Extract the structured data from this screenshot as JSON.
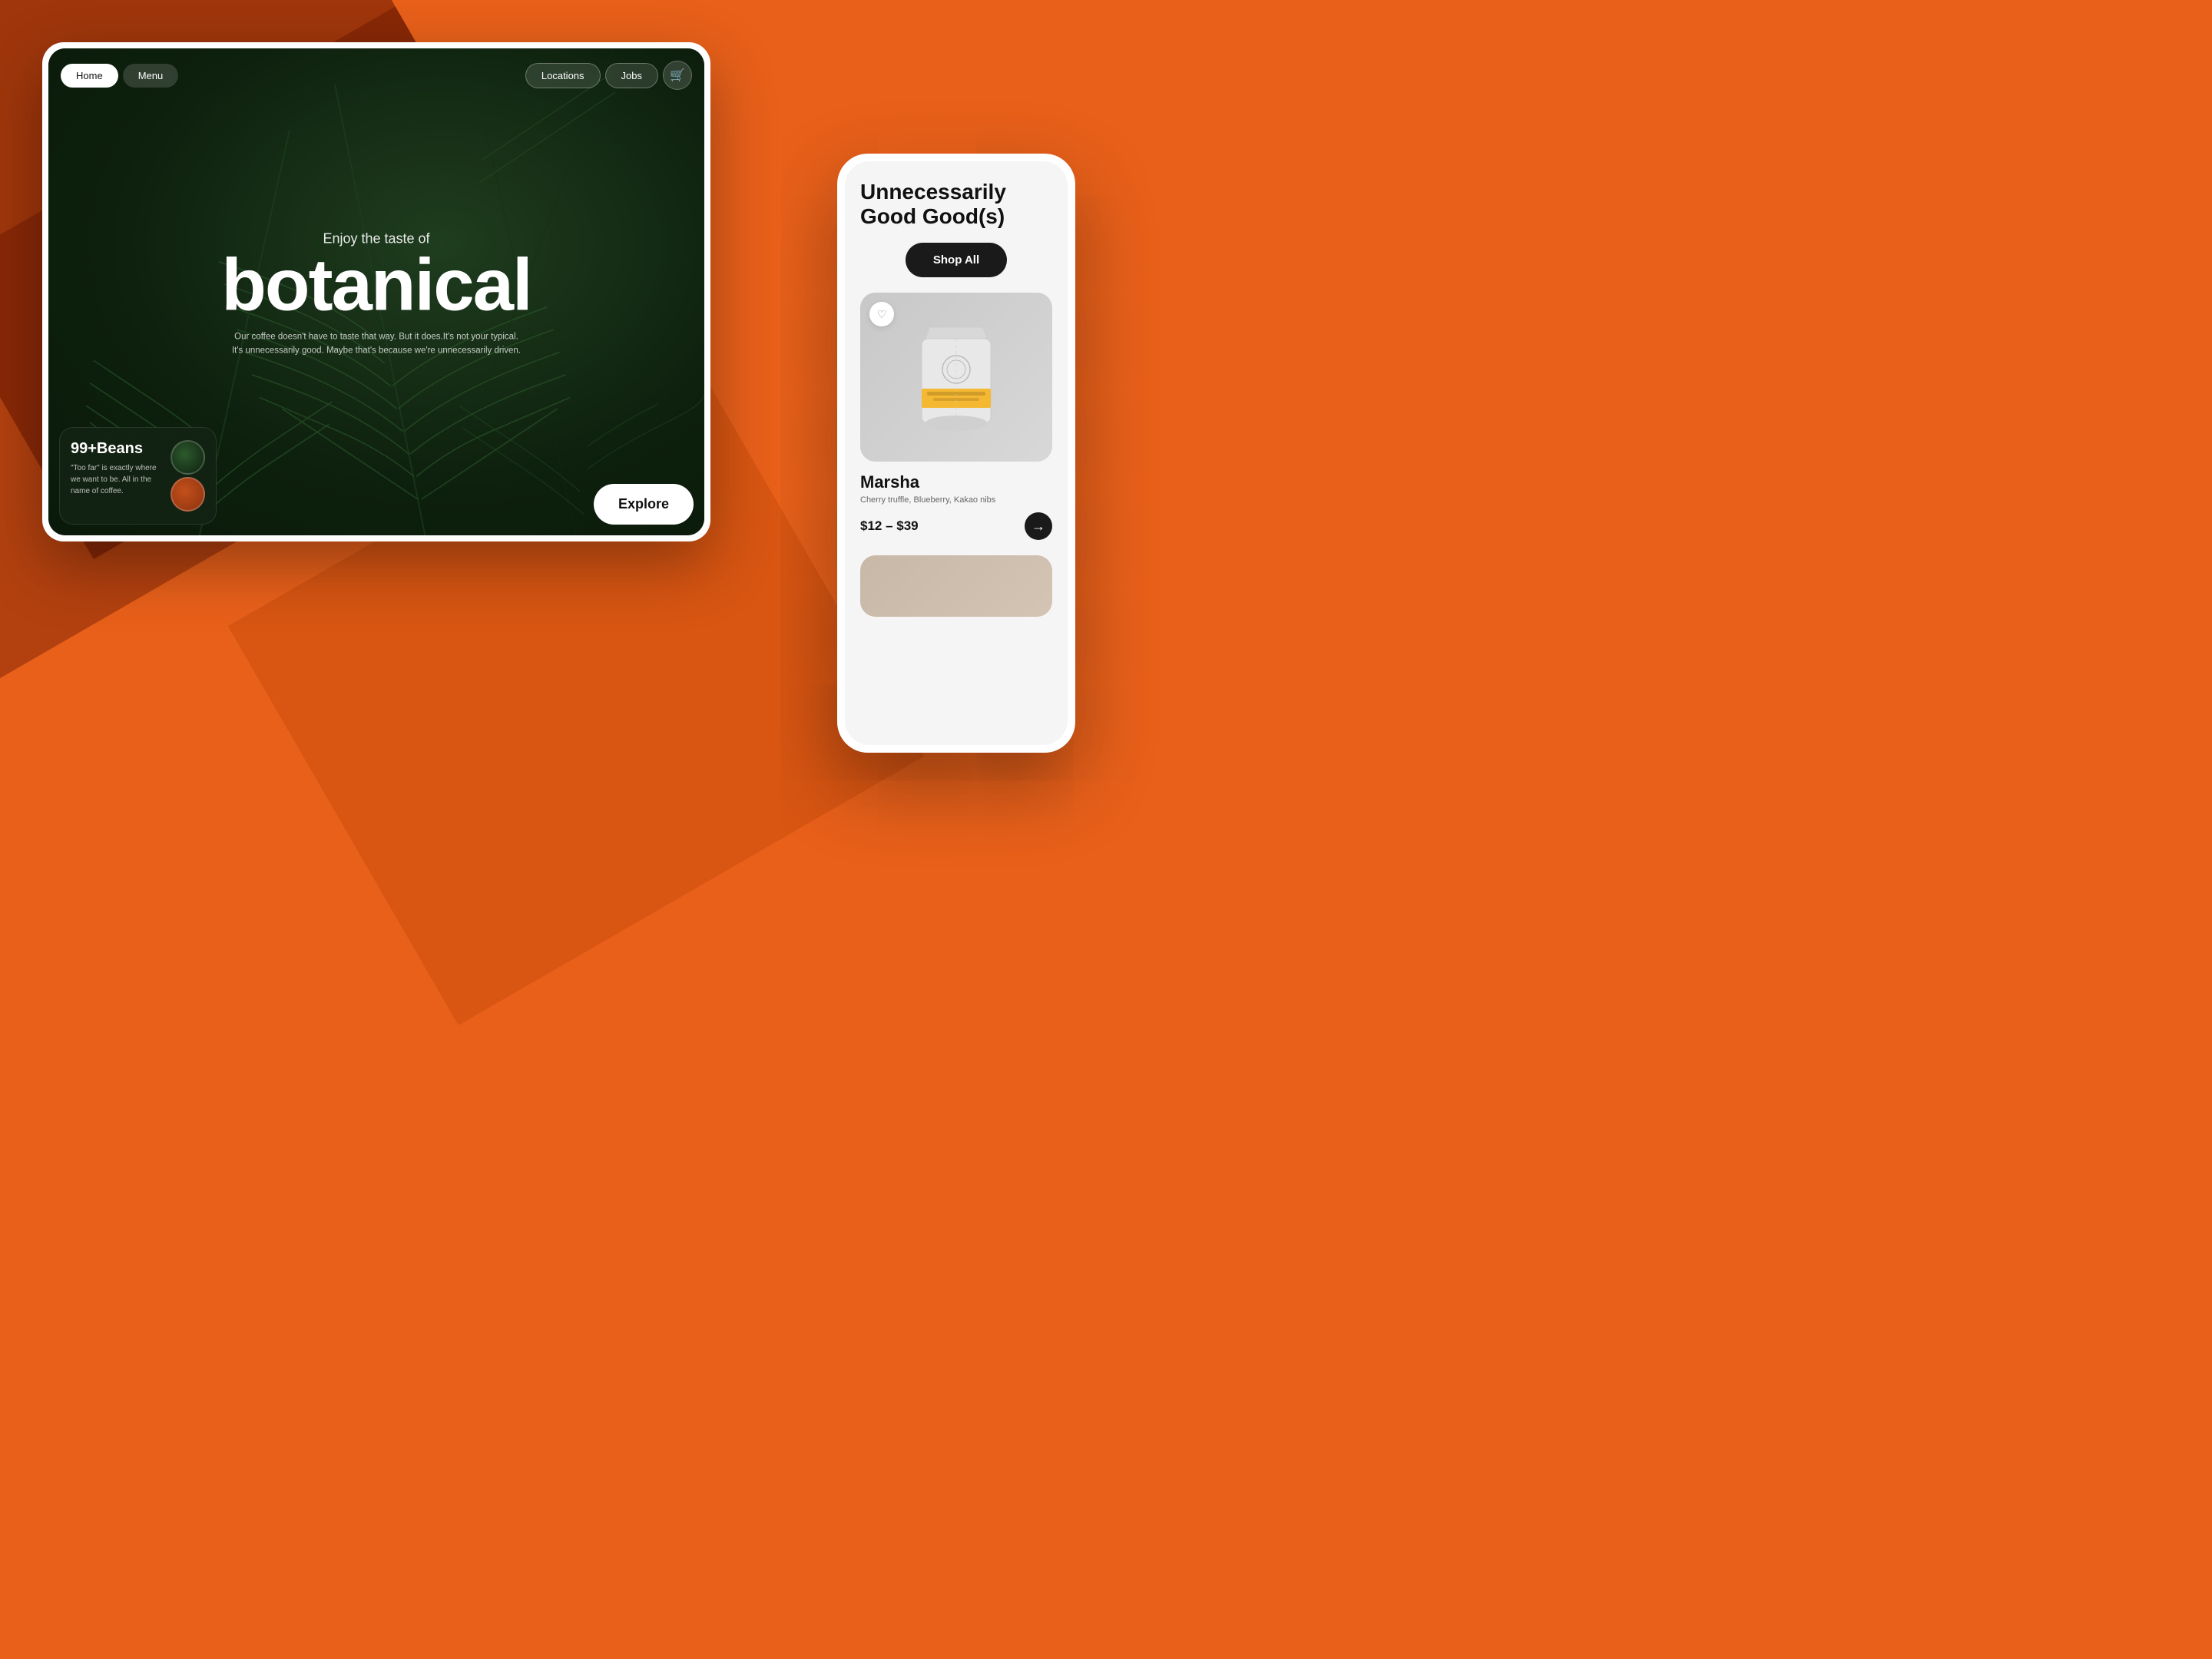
{
  "background": {
    "color": "#e8601a"
  },
  "tablet": {
    "nav": {
      "home_label": "Home",
      "menu_label": "Menu",
      "locations_label": "Locations",
      "jobs_label": "Jobs",
      "cart_icon": "🛒"
    },
    "hero": {
      "subtitle": "Enjoy the taste of",
      "title": "botanical",
      "description": "Our coffee doesn't have to taste that way. But it does.It's not your typical. It's unnecessarily good. Maybe that's because we're unnecessarily driven."
    },
    "beans_card": {
      "title": "99+Beans",
      "description": "\"Too far\" is exactly where we want to be. All in the name of coffee."
    },
    "explore_btn": "Explore"
  },
  "phone": {
    "heading_line1": "Unnecessarily",
    "heading_line2": "Good Good(s)",
    "shop_all_label": "Shop All",
    "product": {
      "name": "Marsha",
      "flavors": "Cherry truffle, Blueberry, Kakao nibs",
      "price": "$12 – $39",
      "add_icon": "→",
      "favorite_icon": "♡"
    }
  }
}
